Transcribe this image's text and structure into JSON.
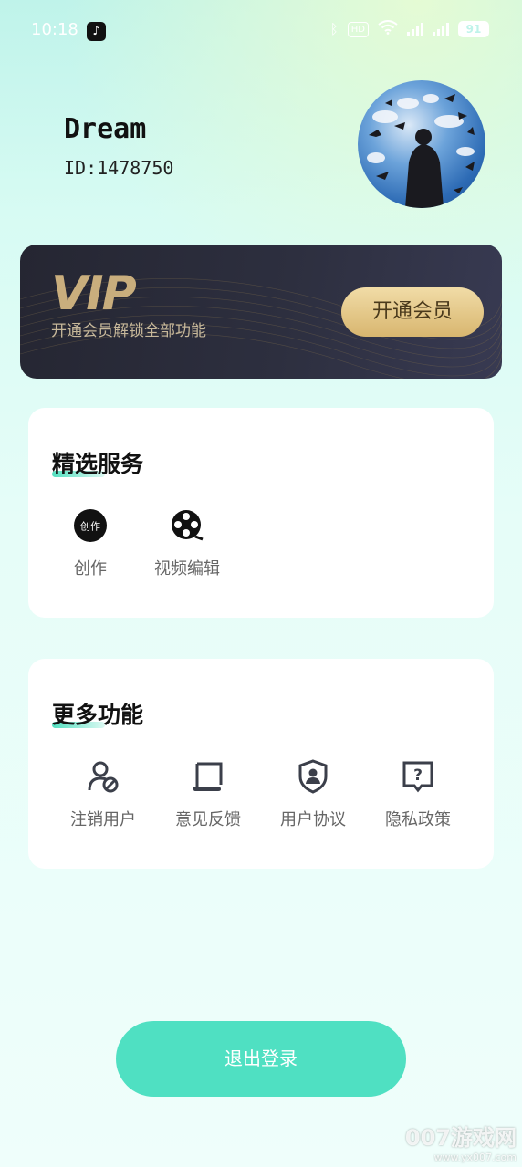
{
  "status_bar": {
    "time": "10:18",
    "hd_badge": "HD",
    "battery": "91"
  },
  "user": {
    "name": "Dream",
    "id": "ID:1478750"
  },
  "vip": {
    "logo": "VIP",
    "description": "开通会员解锁全部功能",
    "button_label": "开通会员"
  },
  "featured_services": {
    "title": "精选服务",
    "items": [
      {
        "label": "创作",
        "icon": "create-icon",
        "icon_text": "创作"
      },
      {
        "label": "视频编辑",
        "icon": "film-reel-icon"
      }
    ]
  },
  "more_functions": {
    "title": "更多功能",
    "items": [
      {
        "label": "注销用户",
        "icon": "user-cancel-icon"
      },
      {
        "label": "意见反馈",
        "icon": "scroll-feedback-icon"
      },
      {
        "label": "用户协议",
        "icon": "shield-user-icon"
      },
      {
        "label": "隐私政策",
        "icon": "question-box-icon"
      }
    ]
  },
  "logout": {
    "label": "退出登录"
  },
  "watermark": {
    "main": "007游戏网",
    "url": "www.yx007.com"
  },
  "colors": {
    "accent": "#4fe0c2",
    "vip_gold": "#c9ae7d",
    "vip_card": "#2d2f3f"
  }
}
